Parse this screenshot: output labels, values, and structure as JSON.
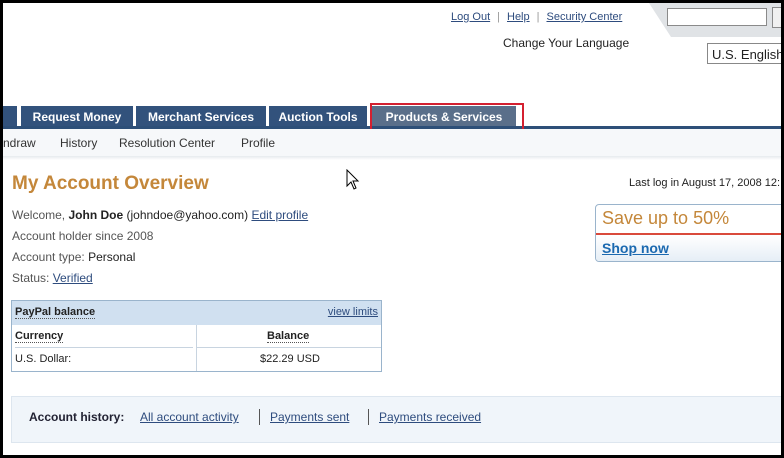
{
  "top_links": {
    "logout": "Log Out",
    "help": "Help",
    "security": "Security Center"
  },
  "language": {
    "prompt": "Change Your Language",
    "selected": "U.S. English"
  },
  "tabs": [
    "Request Money",
    "Merchant Services",
    "Auction Tools",
    "Products & Services"
  ],
  "subnav": [
    "ndraw",
    "History",
    "Resolution Center",
    "Profile"
  ],
  "page_title": "My Account Overview",
  "last_login": "Last log in August 17, 2008 12:",
  "account": {
    "welcome_label": "Welcome,",
    "name": "John Doe",
    "email": "(johndoe@yahoo.com)",
    "edit_profile": "Edit profile",
    "holder_since": "Account holder since 2008",
    "type_label": "Account type:",
    "type_value": "Personal",
    "status_label": "Status:",
    "status_value": "Verified"
  },
  "promo": {
    "headline": "Save up to 50%",
    "cta": "Shop now"
  },
  "balance": {
    "title": "PayPal balance",
    "view_limits": "view limits",
    "col_currency": "Currency",
    "col_balance": "Balance",
    "currency": "U.S. Dollar:",
    "amount": "$22.29 USD"
  },
  "history": {
    "label": "Account history:",
    "all": "All account activity",
    "sent": "Payments sent",
    "received": "Payments received"
  },
  "colors": {
    "nav": "#2d4f78",
    "title": "#c4873a",
    "link": "#2e4c7e",
    "highlight": "#d42030"
  }
}
